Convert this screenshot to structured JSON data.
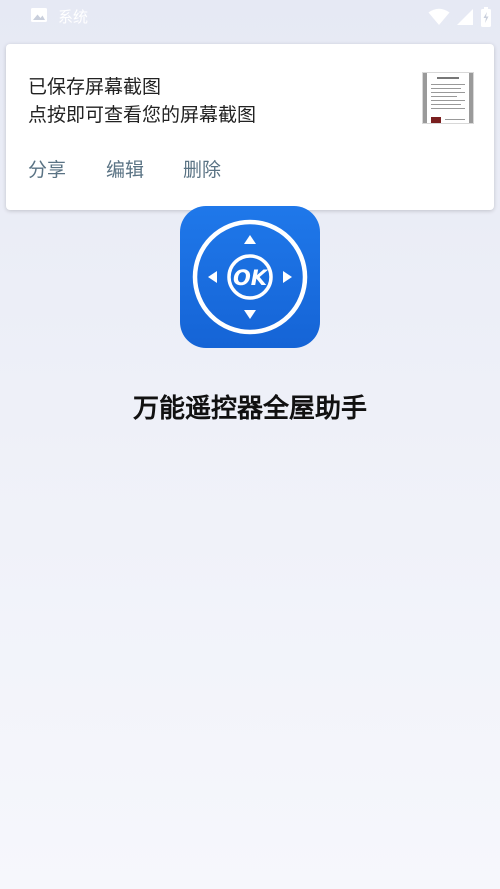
{
  "status_bar": {
    "notification_label": "系统",
    "icons": [
      "image-icon",
      "wifi-icon",
      "signal-icon",
      "battery-icon"
    ]
  },
  "notification": {
    "title": "已保存屏幕截图",
    "text": "点按即可查看您的屏幕截图",
    "actions": {
      "share": "分享",
      "edit": "编辑",
      "delete": "删除"
    },
    "thumbnail_icon": "screenshot-thumbnail"
  },
  "app": {
    "name": "万能遥控器全屋助手",
    "logo_text": "OK",
    "logo_icon": "remote-dpad-icon"
  },
  "colors": {
    "logo_blue": "#1a6fe0",
    "action_text": "#5a7384",
    "background": "#eceef7"
  }
}
